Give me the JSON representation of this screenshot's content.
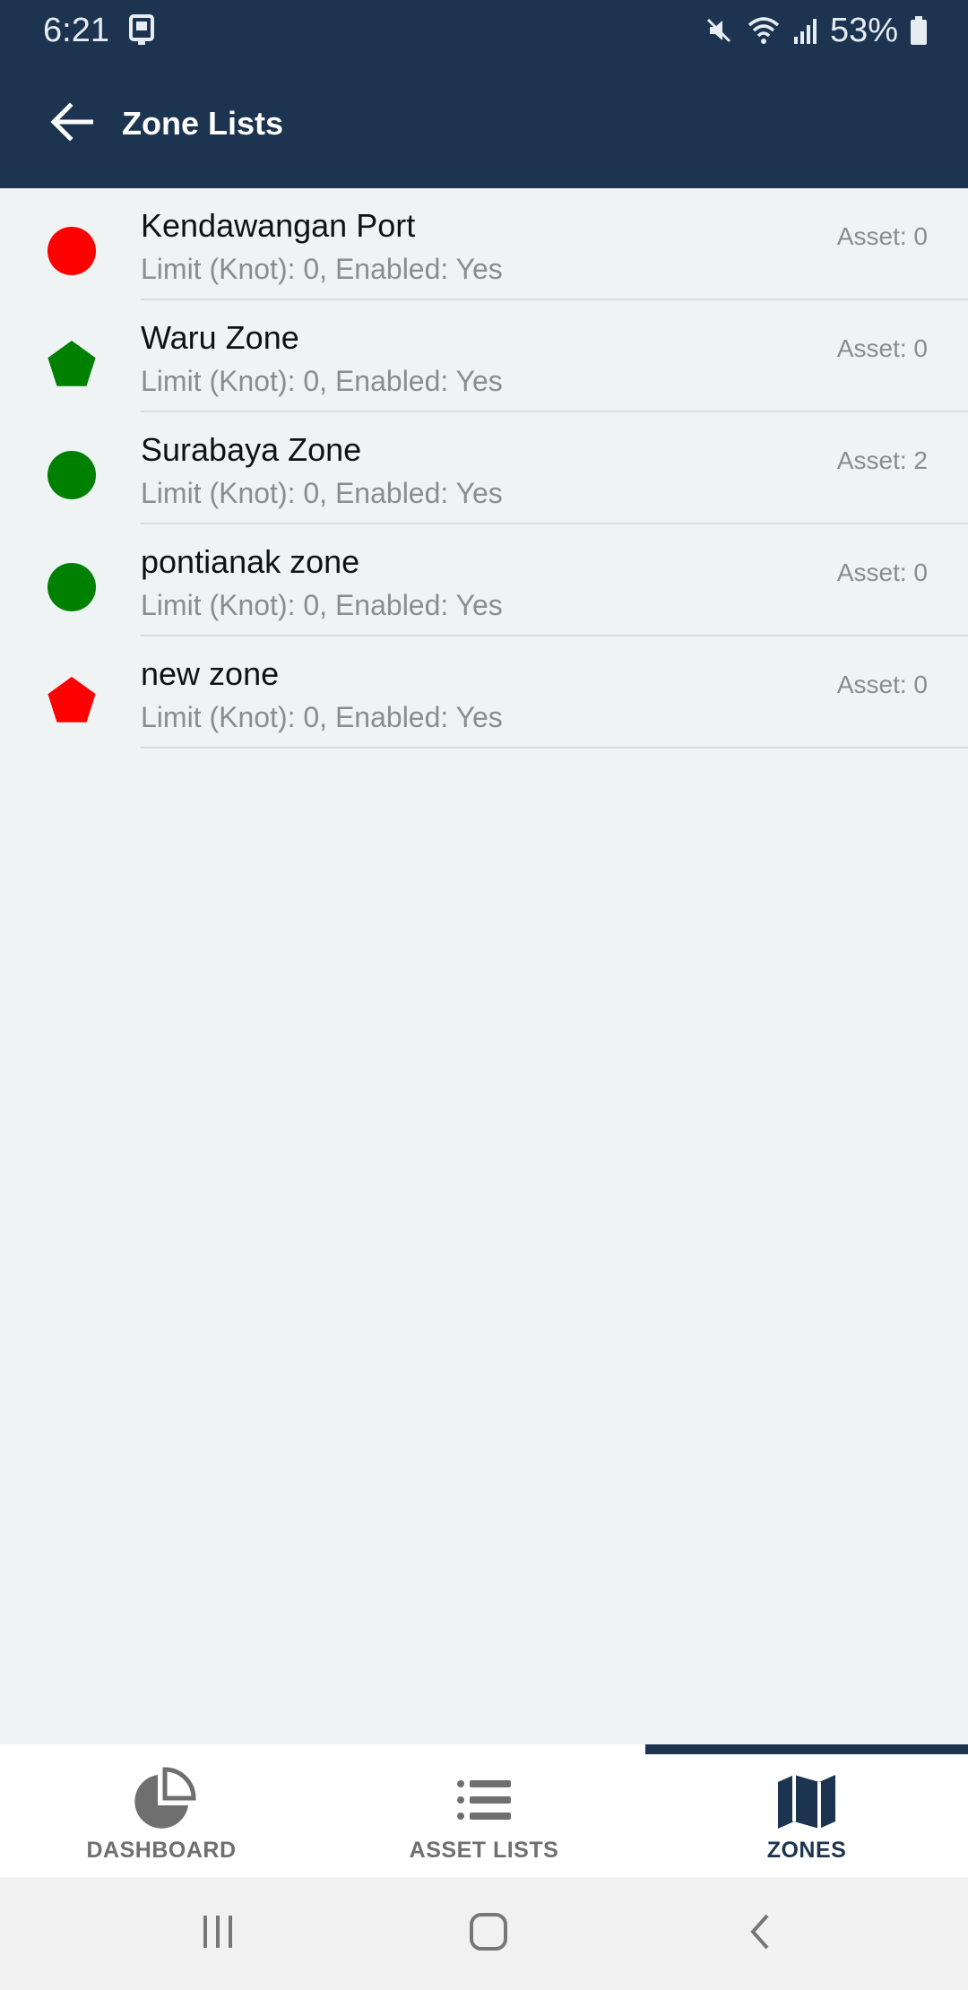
{
  "status_bar": {
    "time": "6:21",
    "battery_percent": "53%",
    "icons": [
      "notification-device-icon",
      "mute-icon",
      "wifi-icon",
      "signal-icon",
      "battery-icon"
    ]
  },
  "header": {
    "title": "Zone Lists",
    "back_icon": "arrow-left-icon"
  },
  "zones": [
    {
      "name": "Kendawangan Port",
      "detail": "Limit (Knot): 0, Enabled: Yes",
      "asset": "Asset: 0",
      "shape": "circle",
      "color": "#ff0000"
    },
    {
      "name": "Waru Zone",
      "detail": "Limit (Knot): 0, Enabled: Yes",
      "asset": "Asset: 0",
      "shape": "pentagon",
      "color": "#008000"
    },
    {
      "name": "Surabaya Zone",
      "detail": "Limit (Knot): 0, Enabled: Yes",
      "asset": "Asset: 2",
      "shape": "circle",
      "color": "#008000"
    },
    {
      "name": "pontianak zone",
      "detail": "Limit (Knot): 0, Enabled: Yes",
      "asset": "Asset: 0",
      "shape": "circle",
      "color": "#008000"
    },
    {
      "name": "new zone",
      "detail": "Limit (Knot): 0, Enabled: Yes",
      "asset": "Asset: 0",
      "shape": "pentagon",
      "color": "#ff0000"
    }
  ],
  "bottom_nav": {
    "items": [
      {
        "label": "DASHBOARD",
        "icon": "pie-chart-icon",
        "active": false
      },
      {
        "label": "ASSET LISTS",
        "icon": "list-icon",
        "active": false
      },
      {
        "label": "ZONES",
        "icon": "map-icon",
        "active": true
      }
    ]
  },
  "system_nav": {
    "icons": [
      "recent-apps-icon",
      "home-icon",
      "back-icon"
    ]
  },
  "colors": {
    "primary": "#1c344f",
    "background": "#eff3f4",
    "secondary_text": "#8a8d90",
    "nav_inactive": "#6f6f6f"
  }
}
